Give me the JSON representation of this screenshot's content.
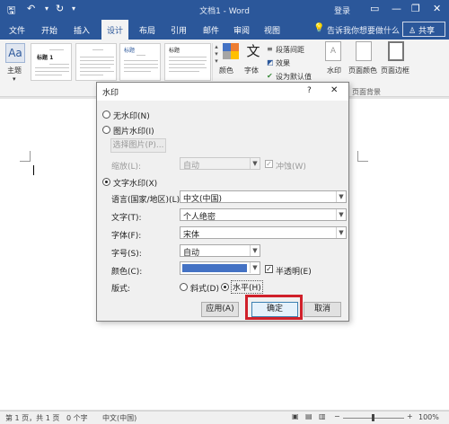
{
  "app": {
    "title": "文档1 - Word",
    "login": "登录",
    "minimize": "—",
    "restore": "❐",
    "close": "✕"
  },
  "tabs": {
    "file": "文件",
    "home": "开始",
    "insert": "插入",
    "design": "设计",
    "layout": "布局",
    "references": "引用",
    "mailings": "邮件",
    "review": "审阅",
    "view": "视图",
    "tellme": "告诉我你想要做什么",
    "share": "共享"
  },
  "ribbon": {
    "themes": "主题",
    "colors": "颜色",
    "fonts": "字体",
    "paragraph_spacing": "段落间距",
    "effects": "效果",
    "set_default": "设为默认值",
    "watermark": "水印",
    "page_color": "页面颜色",
    "page_borders": "页面边框",
    "page_background": "页面背景",
    "style_title": "标题",
    "style_heading1": "标题 1"
  },
  "dialog": {
    "title": "水印",
    "help": "?",
    "close": "✕",
    "no_watermark": "无水印(N)",
    "picture_watermark": "图片水印(I)",
    "select_picture": "选择图片(P)...",
    "scale_label": "缩放(L):",
    "scale_value": "自动",
    "washout": "冲蚀(W)",
    "text_watermark": "文字水印(X)",
    "language_label": "语言(国家/地区)(L):",
    "language_value": "中文(中国)",
    "text_label": "文字(T):",
    "text_value": "个人绝密",
    "font_label": "字体(F):",
    "font_value": "宋体",
    "size_label": "字号(S):",
    "size_value": "自动",
    "color_label": "颜色(C):",
    "color_value": "#4472c4",
    "semitransparent": "半透明(E)",
    "layout_label": "版式:",
    "diagonal": "斜式(D)",
    "horizontal": "水平(H)",
    "apply": "应用(A)",
    "ok": "确定",
    "cancel": "取消"
  },
  "status": {
    "page": "第 1 页，共 1 页",
    "words": "0 个字",
    "language": "中文(中国)",
    "zoom": "100%",
    "zoom_minus": "−",
    "zoom_plus": "+"
  }
}
